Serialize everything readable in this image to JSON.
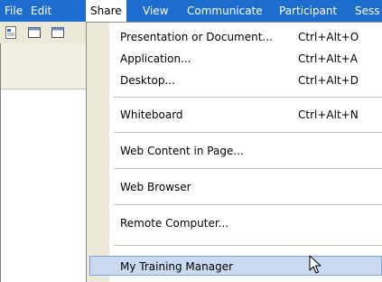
{
  "menubar": {
    "items": [
      {
        "label": "File"
      },
      {
        "label": "Edit"
      },
      {
        "label": "Share"
      },
      {
        "label": "View"
      },
      {
        "label": "Communicate"
      },
      {
        "label": "Participant"
      },
      {
        "label": "Sess"
      }
    ]
  },
  "share_menu": {
    "items": [
      {
        "label": "Presentation or Document...",
        "shortcut": "Ctrl+Alt+O"
      },
      {
        "label": "Application...",
        "shortcut": "Ctrl+Alt+A"
      },
      {
        "label": "Desktop...",
        "shortcut": "Ctrl+Alt+D"
      },
      {
        "label": "Whiteboard",
        "shortcut": "Ctrl+Alt+N"
      },
      {
        "label": "Web Content in Page...",
        "shortcut": ""
      },
      {
        "label": "Web Browser",
        "shortcut": ""
      },
      {
        "label": "Remote Computer...",
        "shortcut": ""
      },
      {
        "label": "My Training Manager",
        "shortcut": ""
      }
    ],
    "highlighted_item": "My Training Manager"
  },
  "colors": {
    "menubar_bg": "#1d6dcf",
    "highlight_bg": "#c9d9ef",
    "highlight_border": "#7ea2d6"
  },
  "icons": [
    "document-icon",
    "window-icon",
    "window-icon",
    "arrow-cursor-icon"
  ]
}
